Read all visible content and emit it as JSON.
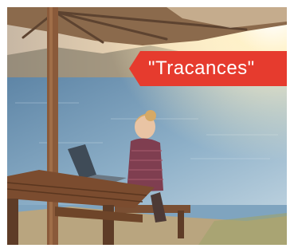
{
  "tag": {
    "label": "\"Tracances\""
  },
  "colors": {
    "tag": "#e63b2e",
    "water": "#7fa4bf",
    "wood": "#8a5a3a",
    "sun": "#fff2c8"
  }
}
